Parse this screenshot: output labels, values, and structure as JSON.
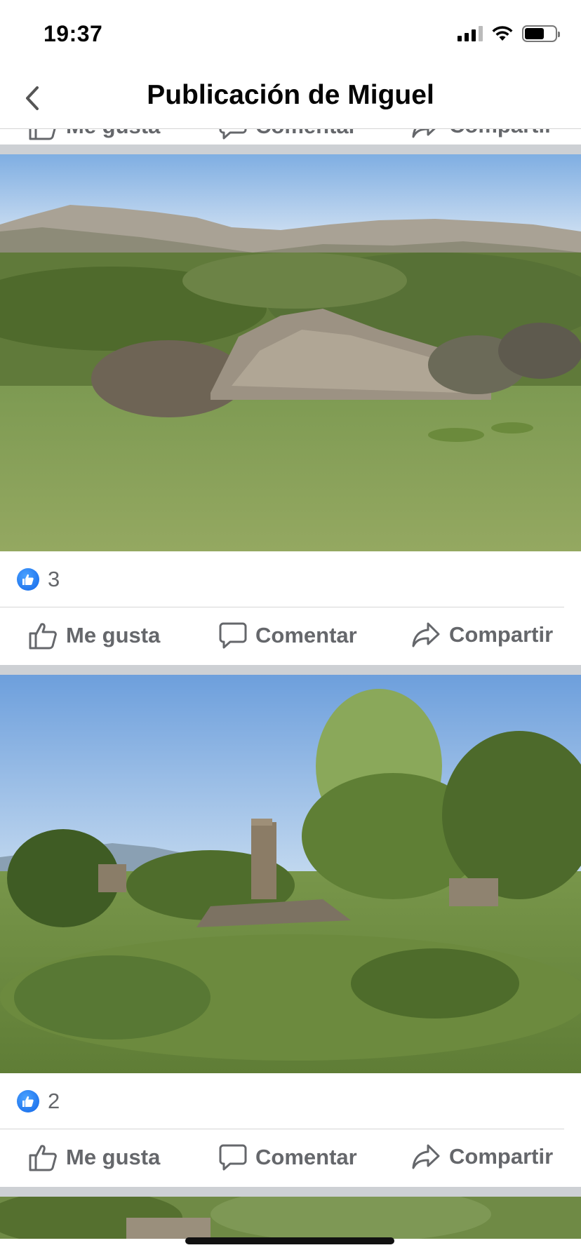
{
  "status_bar": {
    "time": "19:37",
    "battery_level": 0.64
  },
  "header": {
    "title": "Publicación de Miguel",
    "back_icon": "chevron-left-icon"
  },
  "actions": {
    "like": "Me gusta",
    "comment": "Comentar",
    "share": "Compartir"
  },
  "posts": [
    {
      "reaction_count": "3",
      "photo_description": "rubble-mound-meadow"
    },
    {
      "reaction_count": "2",
      "photo_description": "ruined-stone-chimney"
    }
  ],
  "colors": {
    "accent_blue": "#1877f2",
    "text_secondary": "#65676b",
    "divider": "#cdd0d4"
  }
}
